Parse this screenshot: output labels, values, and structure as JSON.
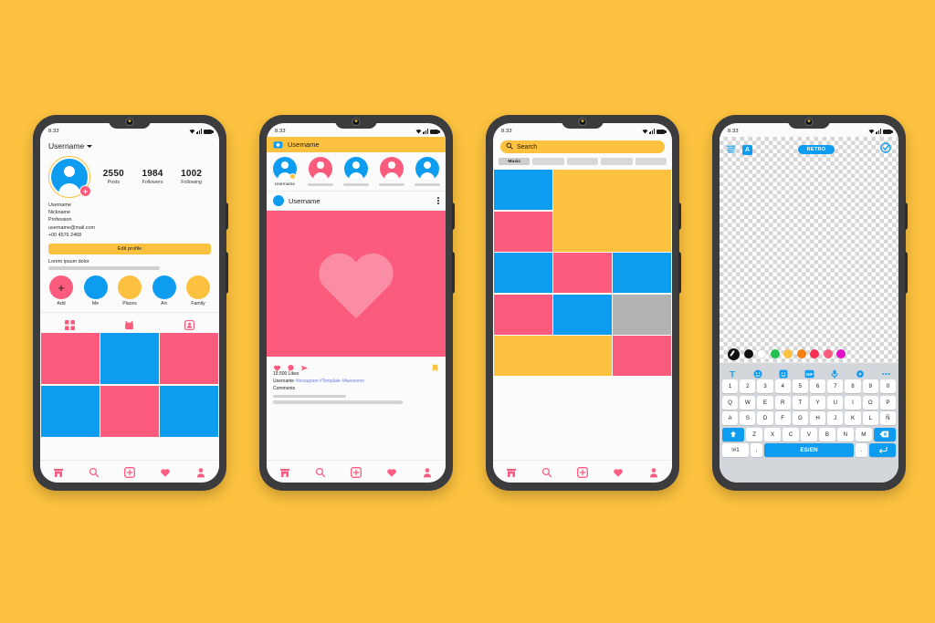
{
  "background_color": "#fcc23f",
  "palette": {
    "yellow": "#fcc23f",
    "pink": "#fb5c7e",
    "blue": "#0d9cf0",
    "gray": "#b3b3b3",
    "light_pink": "#fb8ca6",
    "frame": "#3c3c3f"
  },
  "status_bar": {
    "time": "8.33",
    "wifi": "wifi-icon",
    "signal": "signal-icon",
    "battery": "battery-icon"
  },
  "phone1": {
    "name": "profile-screen",
    "header": {
      "username": "Username",
      "caret": "chevron-down-icon"
    },
    "avatar": {
      "name": "profile-avatar",
      "add_badge": "+"
    },
    "stats": [
      {
        "value": "2550",
        "label": "Posts"
      },
      {
        "value": "1984",
        "label": "Followers"
      },
      {
        "value": "1002",
        "label": "Following"
      }
    ],
    "bio": {
      "line1": "Username",
      "line2": "Nickname",
      "line3": "Profession",
      "line4": "username@mail.com",
      "line5": "+00 4576 2468"
    },
    "edit_button": "Edit profile",
    "lorem": "Lorem ipsum dolor",
    "highlights": [
      {
        "label": "Add",
        "color": "#fb5c7e",
        "glyph": "+"
      },
      {
        "label": "Me",
        "color": "#0d9cf0",
        "glyph": ""
      },
      {
        "label": "Places",
        "color": "#fcc23f",
        "glyph": ""
      },
      {
        "label": "Art",
        "color": "#0d9cf0",
        "glyph": ""
      },
      {
        "label": "Family",
        "color": "#fcc23f",
        "glyph": ""
      }
    ],
    "tabs": [
      "grid-icon",
      "reels-icon",
      "tagged-icon"
    ],
    "grid_colors": [
      "#fb5c7e",
      "#0d9cf0",
      "#fb5c7e",
      "#0d9cf0",
      "#fb5c7e",
      "#0d9cf0"
    ],
    "bottom_nav": [
      "home-icon",
      "search-icon",
      "add-icon",
      "heart-icon",
      "profile-icon"
    ]
  },
  "phone2": {
    "name": "feed-screen",
    "topbar": {
      "camera": "camera-icon",
      "title": "Username"
    },
    "stories": [
      {
        "label": "Username",
        "color": "#0d9cf0",
        "has_add": true
      },
      {
        "label": "",
        "color": "#fb5c7e",
        "has_add": false
      },
      {
        "label": "",
        "color": "#0d9cf0",
        "has_add": false
      },
      {
        "label": "",
        "color": "#fb5c7e",
        "has_add": false
      },
      {
        "label": "",
        "color": "#0d9cf0",
        "has_add": false
      }
    ],
    "post": {
      "author": "Username",
      "menu": "more-options-icon",
      "image_color": "#fb5c7e",
      "image_glyph": "heart-shape",
      "actions": [
        "heart-icon",
        "comment-icon",
        "share-icon",
        "bookmark-icon"
      ],
      "likes": "19.500 Likes",
      "caption_user": "Username",
      "caption_tags": "#Instagram #Template #Awesome",
      "comments_label": "Comments"
    },
    "bottom_nav": [
      "home-icon",
      "search-icon",
      "add-icon",
      "heart-icon",
      "profile-icon"
    ]
  },
  "phone3": {
    "name": "explore-screen",
    "search": {
      "placeholder": "Search",
      "icon": "search-icon"
    },
    "chips": [
      "Music",
      "",
      "",
      "",
      ""
    ],
    "tiles": [
      {
        "color": "#0d9cf0",
        "span": "1x1"
      },
      {
        "color": "#fcc23f",
        "span": "2x2"
      },
      {
        "color": "#fb5c7e",
        "span": "1x1"
      },
      {
        "color": "#0d9cf0",
        "span": "1x1"
      },
      {
        "color": "#fb5c7e",
        "span": "1x1"
      },
      {
        "color": "#0d9cf0",
        "span": "1x1"
      },
      {
        "color": "#fb5c7e",
        "span": "1x1"
      },
      {
        "color": "#0d9cf0",
        "span": "1x1"
      },
      {
        "color": "#b3b3b3",
        "span": "1x1"
      },
      {
        "color": "#fcc23f",
        "span": "2x1"
      },
      {
        "color": "#fb5c7e",
        "span": "1x1"
      }
    ],
    "bottom_nav": [
      "home-icon",
      "search-icon",
      "add-icon",
      "heart-icon",
      "profile-icon"
    ]
  },
  "phone4": {
    "name": "story-editor-screen",
    "toolbar": {
      "align": "align-icon",
      "text_style": "A",
      "filter": "RETRO",
      "confirm": "check-circle-icon"
    },
    "colors": [
      {
        "name": "eyedropper",
        "hex": "#111111"
      },
      {
        "name": "black",
        "hex": "#111111"
      },
      {
        "name": "white",
        "hex": "#ffffff"
      },
      {
        "name": "green",
        "hex": "#1fc04d"
      },
      {
        "name": "yellow",
        "hex": "#fcc23f"
      },
      {
        "name": "orange",
        "hex": "#f98010"
      },
      {
        "name": "red",
        "hex": "#f7304d"
      },
      {
        "name": "pink",
        "hex": "#fb5c7e"
      },
      {
        "name": "magenta",
        "hex": "#e010c8"
      }
    ],
    "keyboard_toolbar": [
      "text-icon",
      "emoji-icon",
      "sticker-icon",
      "gif-icon",
      "mic-icon",
      "settings-icon",
      "more-icon"
    ],
    "keyboard": {
      "row1": [
        "1",
        "2",
        "3",
        "4",
        "5",
        "6",
        "7",
        "8",
        "9",
        "0"
      ],
      "row2": [
        "Q",
        "W",
        "E",
        "R",
        "T",
        "Y",
        "U",
        "I",
        "O",
        "P"
      ],
      "row3": [
        "A",
        "S",
        "D",
        "F",
        "G",
        "H",
        "J",
        "K",
        "L",
        "Ñ"
      ],
      "row4": [
        "Z",
        "X",
        "C",
        "V",
        "B",
        "N",
        "M"
      ],
      "shift": "shift-icon",
      "backspace": "backspace-icon",
      "symbols": "!#1",
      "comma": ",",
      "space": "ES/EN",
      "period": ".",
      "enter": "enter-icon"
    }
  }
}
